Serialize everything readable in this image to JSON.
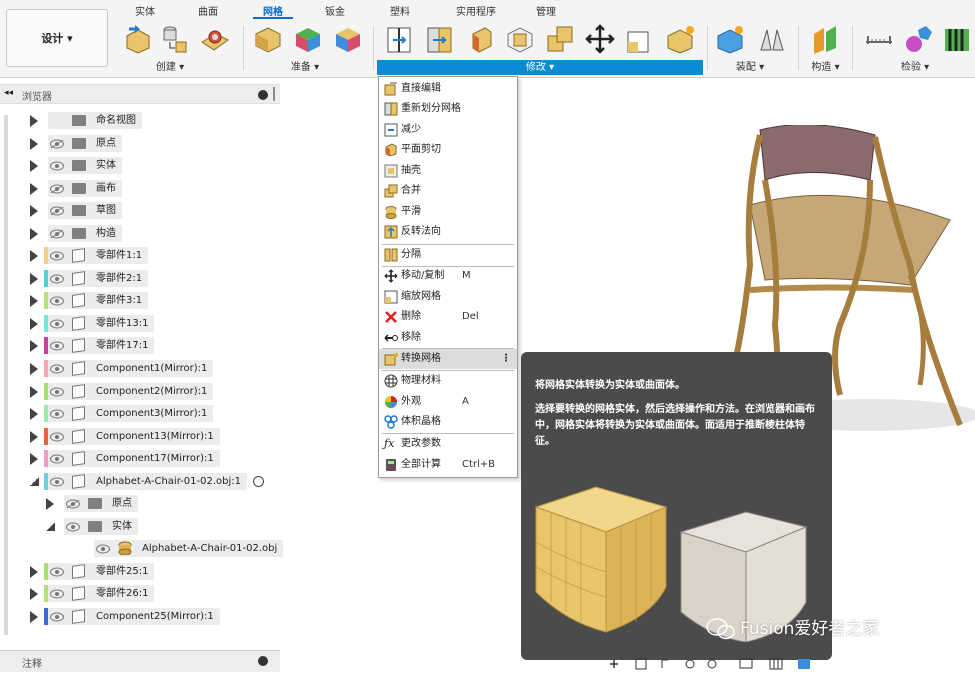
{
  "toolbar": {
    "design_label": "设计 ▾",
    "tabs": [
      "实体",
      "曲面",
      "网格",
      "钣金",
      "塑料",
      "实用程序",
      "管理"
    ],
    "groups": [
      "创建 ▾",
      "准备 ▾",
      "修改 ▾",
      "装配 ▾",
      "构造 ▾",
      "检验 ▾"
    ]
  },
  "browser": {
    "title": "浏览器",
    "rows": [
      {
        "label": "命名视图"
      },
      {
        "label": "原点"
      },
      {
        "label": "实体"
      },
      {
        "label": "画布"
      },
      {
        "label": "草图"
      },
      {
        "label": "构造"
      },
      {
        "label": "零部件1:1"
      },
      {
        "label": "零部件2:1"
      },
      {
        "label": "零部件3:1"
      },
      {
        "label": "零部件13:1"
      },
      {
        "label": "零部件17:1"
      },
      {
        "label": "Component1(Mirror):1"
      },
      {
        "label": "Component2(Mirror):1"
      },
      {
        "label": "Component3(Mirror):1"
      },
      {
        "label": "Component13(Mirror):1"
      },
      {
        "label": "Component17(Mirror):1"
      },
      {
        "label": "Alphabet-A-Chair-01-02.obj:1"
      },
      {
        "label": "原点"
      },
      {
        "label": "实体"
      },
      {
        "label": "Alphabet-A-Chair-01-02.obj"
      },
      {
        "label": "零部件25:1"
      },
      {
        "label": "零部件26:1"
      },
      {
        "label": "Component25(Mirror):1"
      }
    ],
    "notes_label": "注释"
  },
  "menu": {
    "items": [
      {
        "label": "直接编辑",
        "shortcut": ""
      },
      {
        "label": "重新划分网格",
        "shortcut": ""
      },
      {
        "label": "减少",
        "shortcut": ""
      },
      {
        "label": "平面剪切",
        "shortcut": ""
      },
      {
        "label": "抽壳",
        "shortcut": ""
      },
      {
        "label": "合并",
        "shortcut": ""
      },
      {
        "label": "平滑",
        "shortcut": ""
      },
      {
        "label": "反转法向",
        "shortcut": ""
      },
      {
        "label": "分隔",
        "shortcut": ""
      },
      {
        "label": "移动/复制",
        "shortcut": "M"
      },
      {
        "label": "缩放网格",
        "shortcut": ""
      },
      {
        "label": "删除",
        "shortcut": "Del"
      },
      {
        "label": "移除",
        "shortcut": ""
      },
      {
        "label": "转换网格",
        "shortcut": ""
      },
      {
        "label": "物理材料",
        "shortcut": ""
      },
      {
        "label": "外观",
        "shortcut": "A"
      },
      {
        "label": "体积晶格",
        "shortcut": ""
      },
      {
        "label": "更改参数",
        "shortcut": ""
      },
      {
        "label": "全部计算",
        "shortcut": "Ctrl+B"
      }
    ]
  },
  "tooltip": {
    "title": "将网格实体转换为实体或曲面体。",
    "body": "选择要转换的网格实体，然后选择操作和方法。在浏览器和画布中，网格实体将转换为实体或曲面体。面适用于推断棱柱体特征。"
  },
  "watermark": "Fusion爱好者之家",
  "colors": {
    "accent": "#0a8bd6",
    "tooltip_bg": "#4b4b4b"
  }
}
